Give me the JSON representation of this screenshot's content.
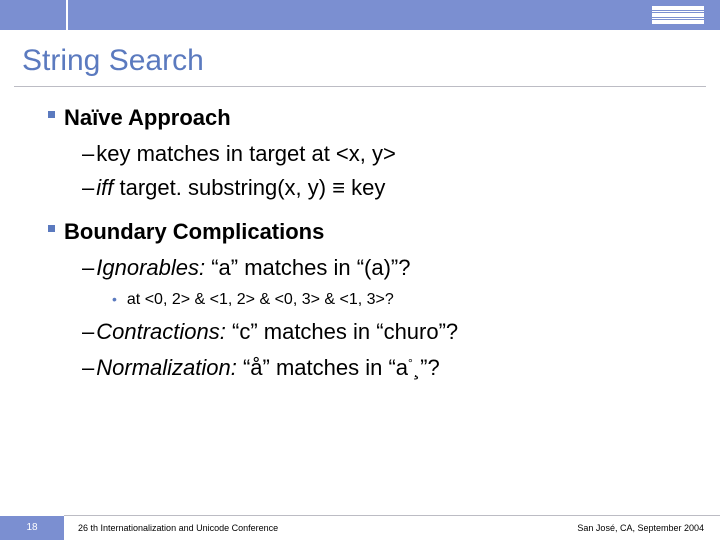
{
  "title": "String Search",
  "sections": [
    {
      "heading": "Naïve Approach",
      "items": [
        {
          "text": "key matches in target at <x, y>"
        },
        {
          "prefix_ital": "iff ",
          "text": "target. substring(x, y) ≡ key"
        }
      ]
    },
    {
      "heading": "Boundary Complications",
      "items": [
        {
          "prefix_ital": "Ignorables:",
          "text": " “a” matches in “(a)”?",
          "sub": "at <0, 2> & <1, 2> & <0, 3> & <1, 3>?"
        },
        {
          "prefix_ital": "Contractions:",
          "text": " “c” matches in “churo”?"
        },
        {
          "prefix_ital": "Normalization:",
          "text": " “å” matches in “a",
          "suffix_sup": "°",
          "tail": "¸”?"
        }
      ]
    }
  ],
  "footer": {
    "slide_no": "18",
    "conference": "26 th Internationalization and Unicode Conference",
    "location": "San José, CA, September 2004"
  }
}
